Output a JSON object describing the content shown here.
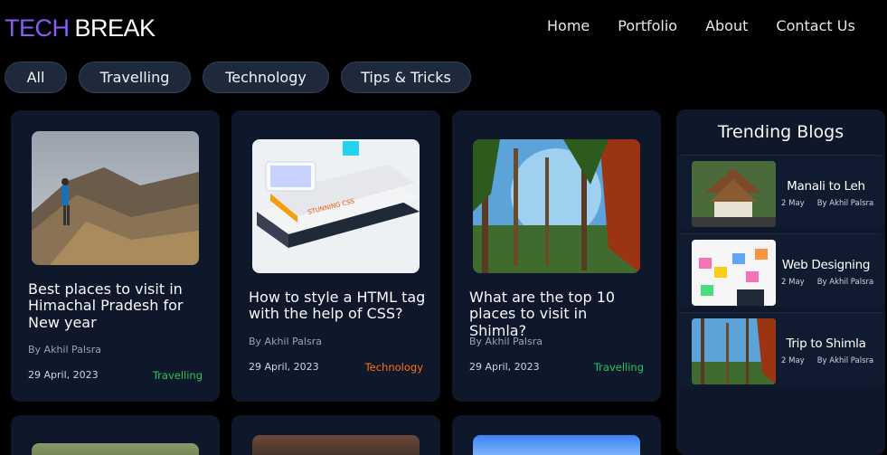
{
  "brand": {
    "part1": "TECH",
    "part2": "BREAK",
    "accent": "#8b5cf6"
  },
  "nav": [
    "Home",
    "Portfolio",
    "About",
    "Contact Us"
  ],
  "filters": [
    "All",
    "Travelling",
    "Technology",
    "Tips & Tricks"
  ],
  "cards": [
    {
      "title": "Best places to visit in Himachal Pradesh for New year",
      "author": "By Akhil Palsra",
      "date": "29 April, 2023",
      "category": "Travelling"
    },
    {
      "title": "How to style a HTML tag with the help of CSS?",
      "author": "By Akhil Palsra",
      "date": "29 April, 2023",
      "category": "Technology"
    },
    {
      "title": "What are the top 10 places to visit in Shimla?",
      "author": "By Akhil Palsra",
      "date": "29 April, 2023",
      "category": "Travelling"
    }
  ],
  "category_colors": {
    "Travelling": "#22c55e",
    "Technology": "#f97316"
  },
  "trending": {
    "heading": "Trending Blogs",
    "items": [
      {
        "title": "Manali to Leh",
        "date": "2 May",
        "author": "By Akhil Palsra"
      },
      {
        "title": "Web Designing",
        "date": "2 May",
        "author": "By Akhil Palsra"
      },
      {
        "title": "Trip to Shimla",
        "date": "2 May",
        "author": "By Akhil Palsra"
      }
    ]
  }
}
